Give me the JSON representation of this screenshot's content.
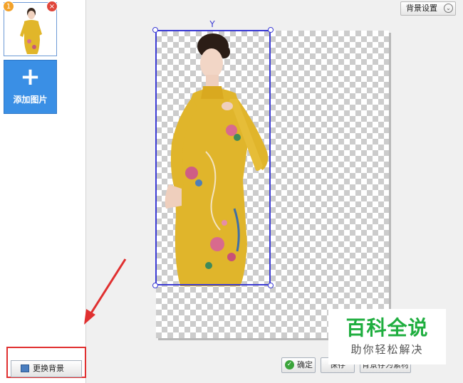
{
  "sidebar": {
    "thumbnail": {
      "index_badge": "1",
      "close_glyph": "×"
    },
    "add_image": {
      "icon_glyph": "+",
      "label": "添加图片"
    },
    "replace_background": {
      "label": "更换背景"
    }
  },
  "toolbar": {
    "background_settings": {
      "label": "背景设置",
      "chevron_glyph": "⌄"
    }
  },
  "canvas": {
    "rotate_glyph": "Y"
  },
  "actions": {
    "confirm": {
      "label": "确定",
      "icon_glyph": "✓"
    },
    "save": {
      "label": "保存"
    },
    "save_as": {
      "label": "背景存为素材"
    }
  },
  "watermark": {
    "title": "百科全说",
    "subtitle": "助你轻松解决"
  },
  "colors": {
    "selection": "#3b3bd4",
    "add_button": "#3a8fe5",
    "highlight_box": "#e03030",
    "watermark_green": "#1fae3f"
  },
  "icons": [
    "close-icon",
    "plus-icon",
    "chevron-down-icon",
    "rotate-handle-icon",
    "checkmark-icon",
    "image-icon"
  ]
}
